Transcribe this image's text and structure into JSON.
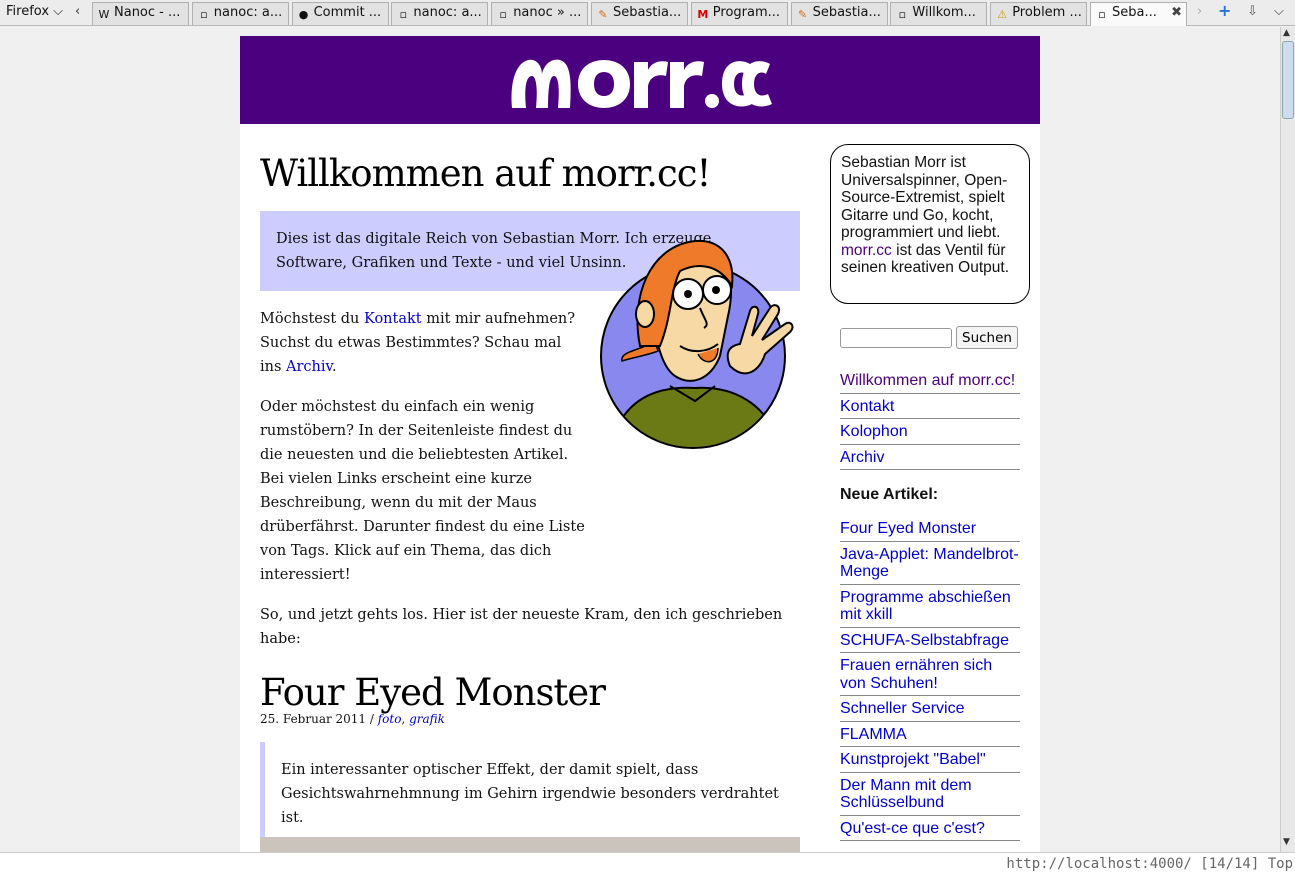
{
  "browser": {
    "menu_label": "Firefox",
    "tabs": [
      {
        "label": "Nanoc - ...",
        "icon": "W"
      },
      {
        "label": "nanoc: a...",
        "icon": ""
      },
      {
        "label": "Commit ...",
        "icon": "github"
      },
      {
        "label": "nanoc: a...",
        "icon": ""
      },
      {
        "label": "nanoc » ...",
        "icon": ""
      },
      {
        "label": "Sebastia...",
        "icon": "carrot"
      },
      {
        "label": "Program...",
        "icon": "M"
      },
      {
        "label": "Sebastia...",
        "icon": "carrot"
      },
      {
        "label": "Willkom...",
        "icon": ""
      },
      {
        "label": "Problem ...",
        "icon": "warning"
      },
      {
        "label": "Seba...",
        "icon": "",
        "active": true
      }
    ],
    "status_text": "http://localhost:4000/ [14/14] Top"
  },
  "site": {
    "logo": "MORR.CC",
    "title": "Willkommen auf morr.cc!",
    "intro": "Dies ist das digitale Reich von Sebastian Morr. Ich erzeuge Software, Grafiken und Texte - und viel Unsinn.",
    "p1_a": "Möchstest du ",
    "p1_link1": "Kontakt",
    "p1_b": " mit mir aufnehmen? Suchst du etwas Bestimmtes? Schau mal ins ",
    "p1_link2": "Archiv",
    "p1_c": ".",
    "p2": "Oder möchstest du einfach ein wenig rumstöbern? In der Seitenleiste findest du die neuesten und die beliebtesten Artikel. Bei vielen Links erscheint eine kurze Beschreibung, wenn du mit der Maus drüberfährst. Darunter findest du eine Liste von Tags. Klick auf ein Thema, das dich interessiert!",
    "p3": "So, und jetzt gehts los. Hier ist der neueste Kram, den ich geschrieben habe:",
    "article": {
      "title": "Four Eyed Monster",
      "date": "25. Februar 2011 / ",
      "tag1": "foto",
      "sep": ", ",
      "tag2": "grafik",
      "quote": "Ein interessanter optischer Effekt, der damit spielt, dass Gesichtswahrnehmnung im Gehirn irgendwie besonders verdrahtet ist."
    }
  },
  "sidebar": {
    "bio_a": "Sebastian Morr ist Universalspinner, Open-Source-Extremist, spielt Gitarre und Go, kocht, programmiert und liebt. ",
    "bio_link": "morr.cc",
    "bio_b": " ist das Ventil für seinen kreativen Output.",
    "search_button": "Suchen",
    "nav": [
      "Willkommen auf morr.cc!",
      "Kontakt",
      "Kolophon",
      "Archiv"
    ],
    "new_heading": "Neue Artikel:",
    "articles": [
      "Four Eyed Monster",
      "Java-Applet: Mandelbrot-Menge",
      "Programme abschießen mit xkill",
      "SCHUFA-Selbstabfrage",
      "Frauen ernähren sich von Schuhen!",
      "Schneller Service",
      "FLAMMA",
      "Kunstprojekt \"Babel\"",
      "Der Mann mit dem Schlüsselbund",
      "Qu'est-ce que c'est?"
    ]
  }
}
